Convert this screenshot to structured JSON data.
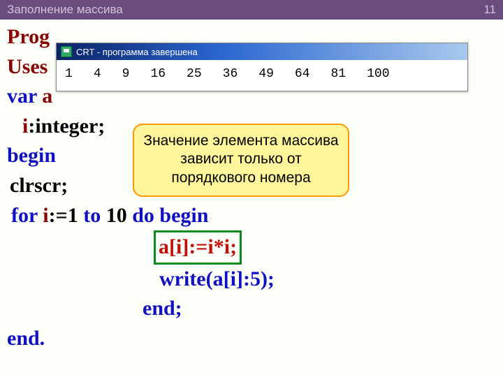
{
  "header": {
    "title": "Заполнение массива",
    "page": "11"
  },
  "crt": {
    "title": "CRT - программа завершена",
    "output": [
      "1",
      "4",
      "9",
      "16",
      "25",
      "36",
      "49",
      "64",
      "81",
      "100"
    ]
  },
  "callout": {
    "l1": "Значение элемента массива",
    "l2": "зависит только от",
    "l3": "порядкового номера"
  },
  "code": {
    "l1a": "Prog",
    "l2a": "Uses",
    "l3a": "var ",
    "l3b": "a",
    "l4a": "i",
    "l4b": ":integer;",
    "l5": "begin",
    "l6": "clrscr;",
    "l7a": "for ",
    "l7b": "i",
    "l7c": ":=1 ",
    "l7d": "to ",
    "l7e": "10 ",
    "l7f": "do begin",
    "l8": "a[i]:=i*i;",
    "l9a": "write(",
    "l9b": "a[i]",
    "l9c": ":5);",
    "l10": "end;",
    "l11": "end."
  }
}
